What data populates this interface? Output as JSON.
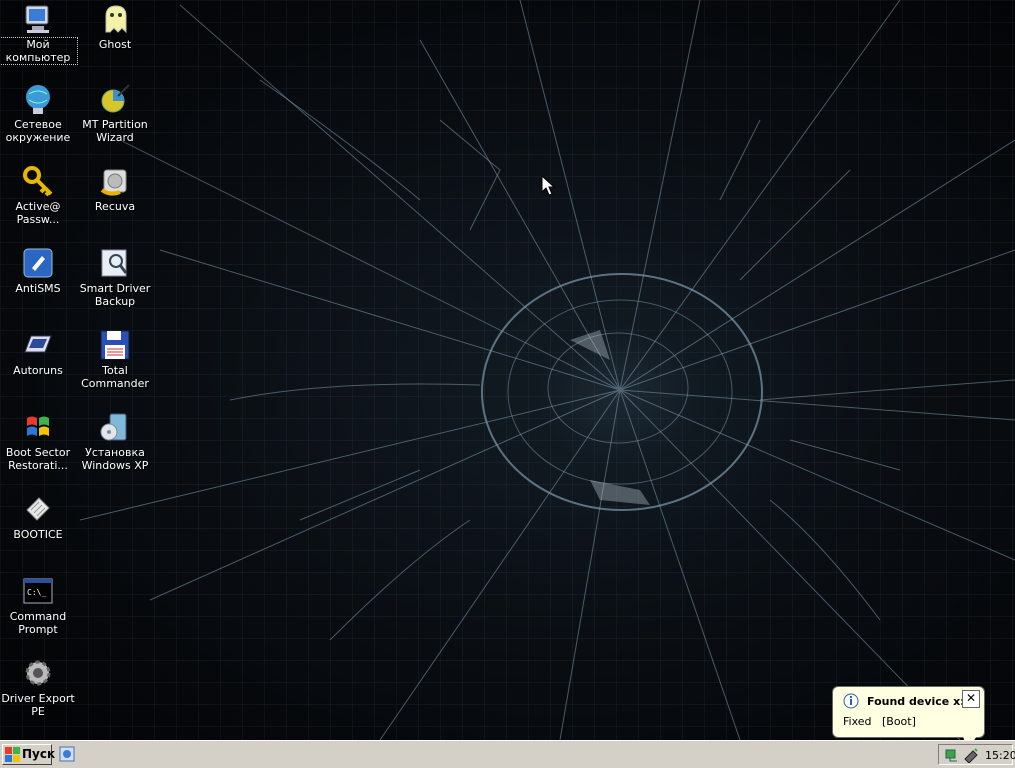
{
  "desktop": {
    "icons": [
      {
        "label": "Мой компьютер",
        "icon": "my-computer-icon"
      },
      {
        "label": "Ghost",
        "icon": "ghost-icon"
      },
      {
        "label": "Сетевое окружение",
        "icon": "network-icon"
      },
      {
        "label": "MT Partition Wizard",
        "icon": "partition-wizard-icon"
      },
      {
        "label": "Active@ Passw...",
        "icon": "key-icon"
      },
      {
        "label": "Recuva",
        "icon": "recuva-icon"
      },
      {
        "label": "AntiSMS",
        "icon": "antisms-icon"
      },
      {
        "label": "Smart Driver Backup",
        "icon": "driver-backup-icon"
      },
      {
        "label": "Autoruns",
        "icon": "autoruns-icon"
      },
      {
        "label": "Total Commander",
        "icon": "floppy-icon"
      },
      {
        "label": "Boot Sector Restorati...",
        "icon": "windows-flag-icon"
      },
      {
        "label": "Установка Windows XP",
        "icon": "windows-setup-icon"
      },
      {
        "label": "BOOTICE",
        "icon": "bootice-icon"
      },
      {
        "label": "Command Prompt",
        "icon": "command-prompt-icon"
      },
      {
        "label": "Driver Export PE",
        "icon": "gear-icon"
      }
    ]
  },
  "balloon": {
    "title": "Found device x:",
    "text": "Fixed   [Boot]",
    "close_label": "✕",
    "icon": "info-icon"
  },
  "taskbar": {
    "start_label": "Пуск",
    "clock": "15:20",
    "tray_icons": [
      "network-tray-icon",
      "drive-tray-icon"
    ]
  },
  "colors": {
    "taskbar": "#d4d0c8",
    "balloon": "#ffffe1"
  }
}
